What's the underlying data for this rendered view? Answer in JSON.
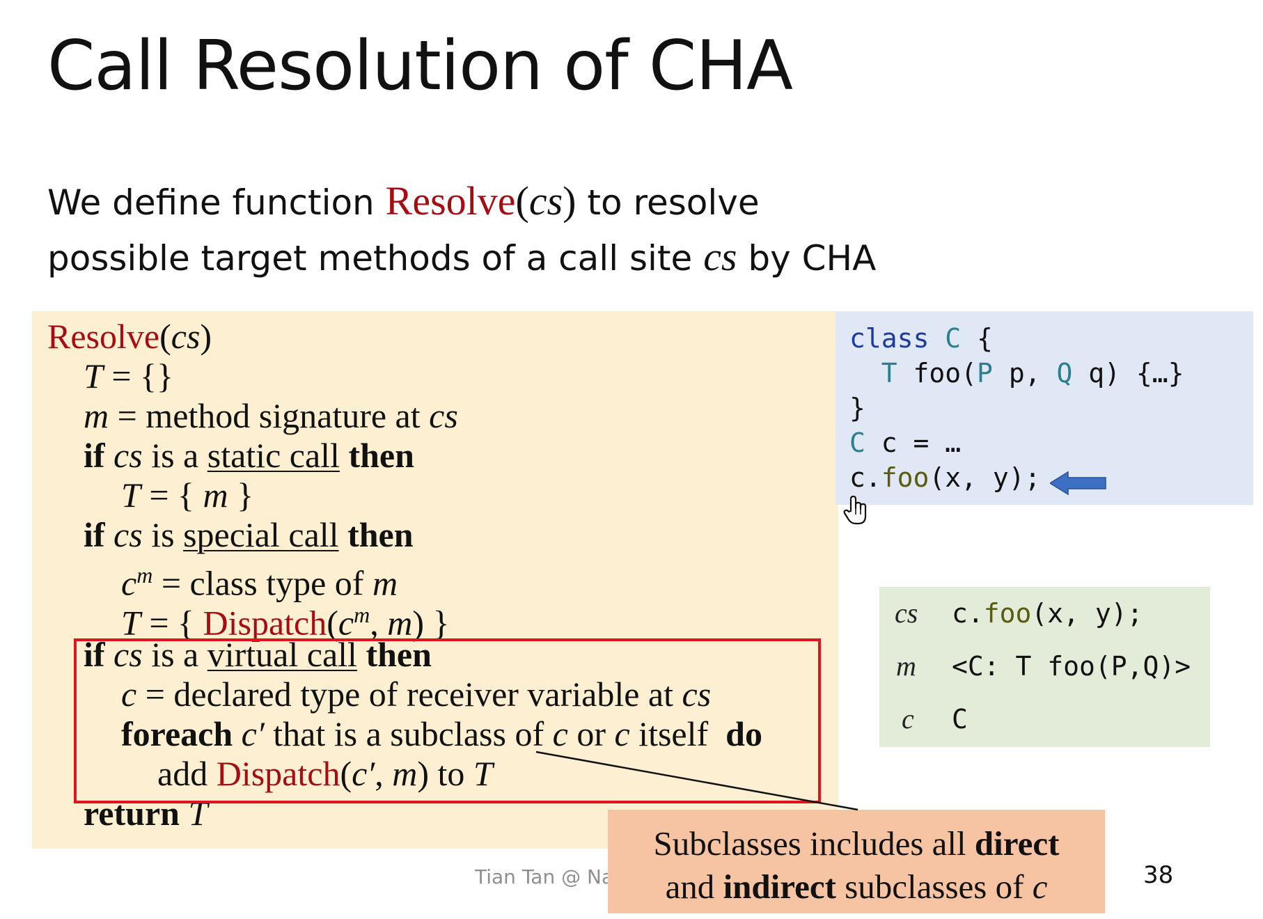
{
  "slide": {
    "title": "Call Resolution of CHA",
    "intro": {
      "line1_before": "We define function ",
      "func": "Resolve",
      "arg_open": "(",
      "arg": "cs",
      "arg_close": ")",
      "line1_after": " to resolve",
      "line2_before": "possible target methods of a call site ",
      "line2_var": "cs",
      "line2_after": " by CHA"
    },
    "footer": "Tian Tan @ Nar",
    "page_number": "38"
  },
  "algorithm": {
    "header": {
      "name": "Resolve",
      "open": "(",
      "arg": "cs",
      "close": ")"
    },
    "init": {
      "var": "T",
      "rest": " = {}"
    },
    "m_line": {
      "var": "m",
      "rest": " = method signature at ",
      "cs": "cs"
    },
    "static_if": {
      "kw_if": "if ",
      "cs": "cs",
      "is": " is a ",
      "call": "static call",
      "kw_then": " then"
    },
    "static_body": {
      "var": "T",
      "open": " = { ",
      "m": "m",
      "close": " }"
    },
    "special_if": {
      "kw_if": "if ",
      "cs": "cs",
      "is": " is ",
      "call": "special call",
      "kw_then": " then"
    },
    "special_cm": {
      "c": "c",
      "sup": "m",
      "rest": " = class type of ",
      "m": "m"
    },
    "special_body": {
      "var": "T",
      "open": " = { ",
      "func": "Dispatch",
      "args_open": "(",
      "c": "c",
      "sup": "m",
      "comma": ", ",
      "m": "m",
      "args_close": ") }"
    },
    "virtual_if": {
      "kw_if": "if ",
      "cs": "cs",
      "is": " is a ",
      "call": "virtual call",
      "kw_then": " then"
    },
    "virtual_c": {
      "c": "c",
      "rest": " = declared type of receiver variable at ",
      "cs": "cs"
    },
    "foreach": {
      "kw": "foreach ",
      "cp": "c′",
      "mid": " that is a subclass of ",
      "c1": "c",
      "or": " or ",
      "c2": "c",
      "itself": " itself  ",
      "kw_do": "do"
    },
    "add": {
      "pre": "add ",
      "func": "Dispatch",
      "open": "(",
      "cp": "c′",
      "comma": ", ",
      "m": "m",
      "close": ") to ",
      "T": "T"
    },
    "ret": {
      "kw": "return ",
      "T": "T"
    }
  },
  "code": {
    "l1_kw": "class",
    "l1_cls": "C",
    "l1_brace": " {",
    "l2_type": "T",
    "l2_name": " foo(",
    "l2_p1t": "P",
    "l2_p1": " p, ",
    "l2_p2t": "Q",
    "l2_p2": " q) {…}",
    "l3": "}",
    "l4_type": "C",
    "l4_rest": " c = …",
    "l5_recv": "c.",
    "l5_call": "foo",
    "l5_args": "(x, y);"
  },
  "variables": [
    {
      "key": "cs",
      "value_a": "c.",
      "value_b": "foo",
      "value_c": "(x, y);"
    },
    {
      "key": "m",
      "value": "<C: T foo(P,Q)>"
    },
    {
      "key": "c",
      "value": "C"
    }
  ],
  "note": {
    "l1_a": "Subclasses includes all ",
    "l1_b": "direct",
    "l2_a": "and ",
    "l2_b": "indirect",
    "l2_c": " subclasses of ",
    "l2_d": "c"
  },
  "colors": {
    "red_text": "#a50d12",
    "algo_bg": "#fdf0d2",
    "code_bg": "#dfe8f4",
    "var_bg": "#e2ecd8",
    "note_bg": "#f6c4a2",
    "highlight_border": "#e0141c",
    "arrow": "#3d6fc2",
    "code_type": "#2b7f8f"
  },
  "icons": [
    "left-arrow-icon",
    "hand-cursor-icon"
  ]
}
